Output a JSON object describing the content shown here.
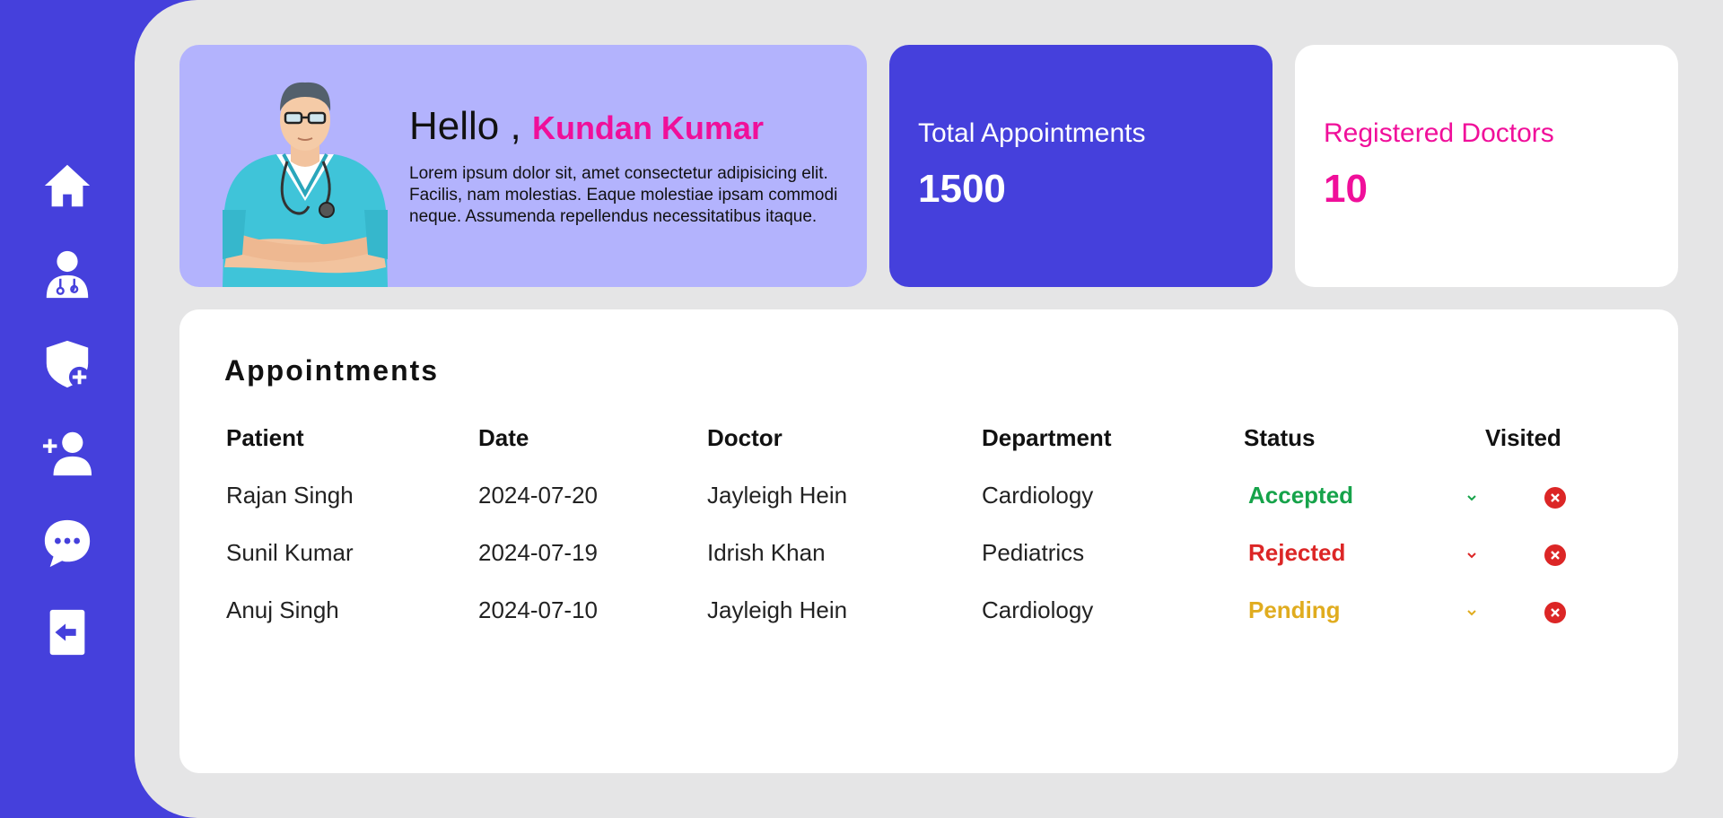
{
  "sidebar": {
    "items": [
      {
        "icon": "home-icon"
      },
      {
        "icon": "doctor-icon"
      },
      {
        "icon": "shield-plus-icon"
      },
      {
        "icon": "add-user-icon"
      },
      {
        "icon": "chat-icon"
      },
      {
        "icon": "logout-icon"
      }
    ]
  },
  "welcome": {
    "greeting": "Hello ,",
    "name": "Kundan Kumar",
    "text": "Lorem ipsum dolor sit, amet consectetur adipisicing elit. Facilis, nam molestias. Eaque molestiae ipsam commodi neque. Assumenda repellendus necessitatibus itaque."
  },
  "stats": {
    "appointments_label": "Total Appointments",
    "appointments_value": "1500",
    "doctors_label": "Registered Doctors",
    "doctors_value": "10"
  },
  "appointments": {
    "title": "Appointments",
    "headers": [
      "Patient",
      "Date",
      "Doctor",
      "Department",
      "Status",
      "Visited"
    ],
    "rows": [
      {
        "patient": "Rajan Singh",
        "date": "2024-07-20",
        "doctor": "Jayleigh Hein",
        "department": "Cardiology",
        "status": "Accepted",
        "status_color": "#16a34a"
      },
      {
        "patient": "Sunil Kumar",
        "date": "2024-07-19",
        "doctor": "Idrish Khan",
        "department": "Pediatrics",
        "status": "Rejected",
        "status_color": "#dc2626"
      },
      {
        "patient": "Anuj Singh",
        "date": "2024-07-10",
        "doctor": "Jayleigh Hein",
        "department": "Cardiology",
        "status": "Pending",
        "status_color": "#e0ac1f"
      }
    ]
  },
  "colors": {
    "primary": "#4540dc",
    "accent": "#f00f9a",
    "welcome_bg": "#b3b3fd",
    "main_bg": "#e5e5e6"
  }
}
